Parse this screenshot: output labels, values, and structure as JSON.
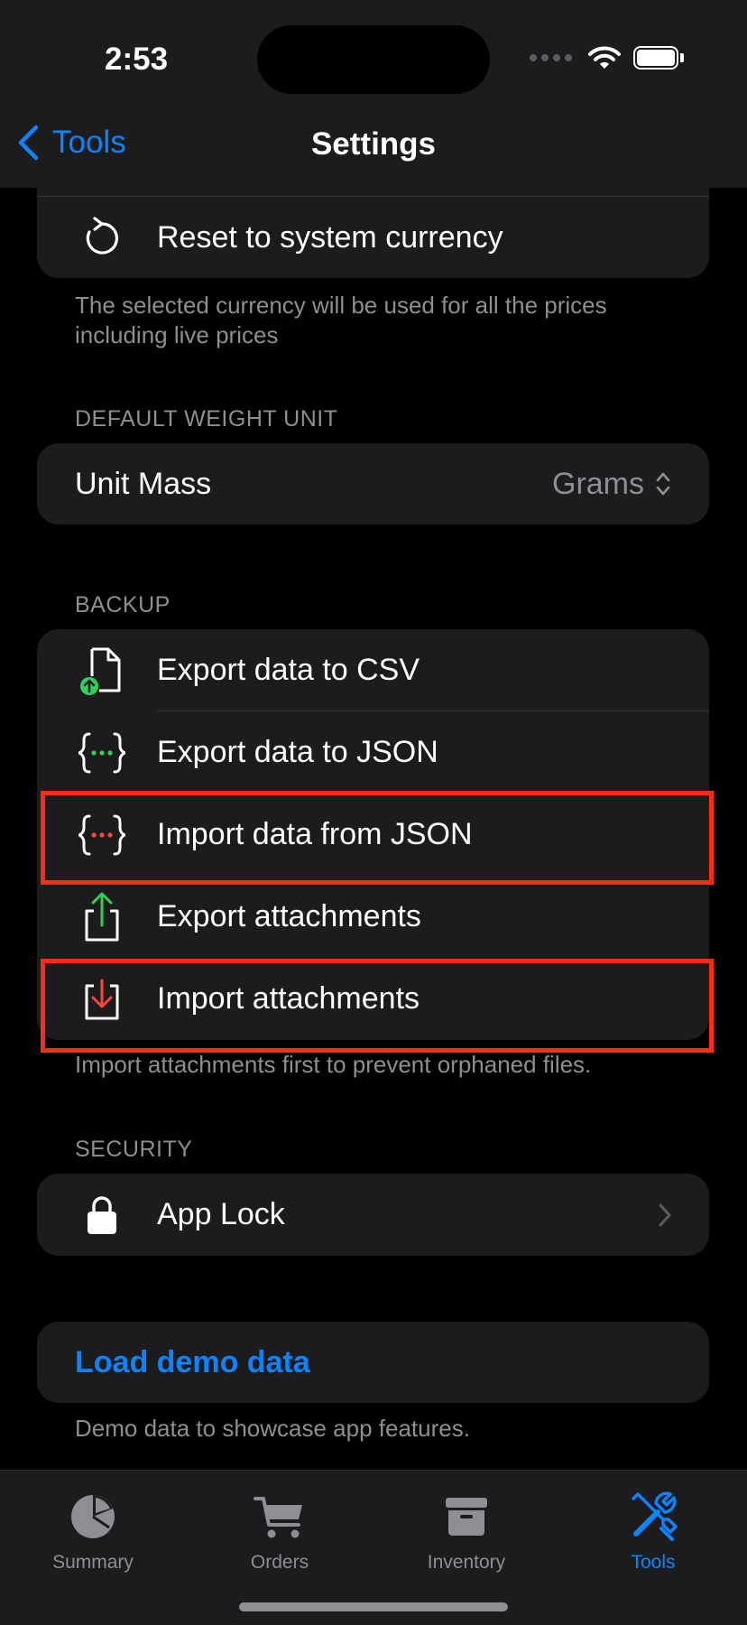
{
  "status_bar": {
    "time": "2:53"
  },
  "nav": {
    "back_label": "Tools",
    "title": "Settings"
  },
  "currency": {
    "reset_label": "Reset to system currency",
    "footer": "The selected currency will be used for all the prices including live prices"
  },
  "weight": {
    "header": "DEFAULT WEIGHT UNIT",
    "label": "Unit Mass",
    "value": "Grams"
  },
  "backup": {
    "header": "BACKUP",
    "items": [
      {
        "label": "Export data to CSV",
        "icon": "csv-export-icon"
      },
      {
        "label": "Export data to JSON",
        "icon": "json-export-icon"
      },
      {
        "label": "Import data from JSON",
        "icon": "json-import-icon"
      },
      {
        "label": "Export attachments",
        "icon": "share-icon"
      },
      {
        "label": "Import attachments",
        "icon": "download-icon"
      }
    ],
    "footer": "Import attachments first to prevent orphaned files."
  },
  "security": {
    "header": "SECURITY",
    "label": "App Lock"
  },
  "demo": {
    "label": "Load demo data",
    "footer": "Demo data to showcase app features."
  },
  "tabs": [
    {
      "label": "Summary",
      "icon": "pie-chart-icon",
      "active": false
    },
    {
      "label": "Orders",
      "icon": "cart-icon",
      "active": false
    },
    {
      "label": "Inventory",
      "icon": "archive-box-icon",
      "active": false
    },
    {
      "label": "Tools",
      "icon": "tools-icon",
      "active": true
    }
  ],
  "colors": {
    "accent": "#0a84ff",
    "highlight": "#ff2d0f",
    "green": "#30d158",
    "red": "#ff453a"
  }
}
